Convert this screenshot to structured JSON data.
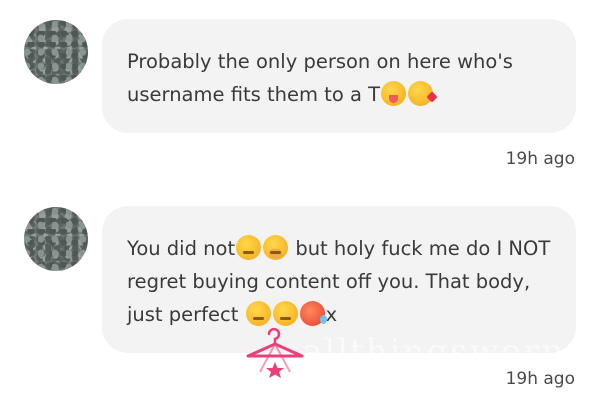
{
  "comments": [
    {
      "segments": [
        "Probably the only person on here who's username fits them to a T"
      ],
      "emojis": [
        "face-with-tongue-emoji",
        "face-blowing-kiss-emoji"
      ],
      "timestamp": "19h ago"
    },
    {
      "segments": [
        "You did not",
        " but holy fuck me do I NOT regret buying content off you. That body, just perfect ",
        "x"
      ],
      "emojis": [
        "smirking-face-emoji",
        "face-with-hand-over-mouth-emoji",
        "winking-face-emoji",
        "smirking-face-emoji",
        "hot-face-emoji"
      ],
      "timestamp": "19h ago"
    }
  ],
  "watermark": {
    "text": "allthingsworn",
    "color": "#ec3e7a"
  }
}
